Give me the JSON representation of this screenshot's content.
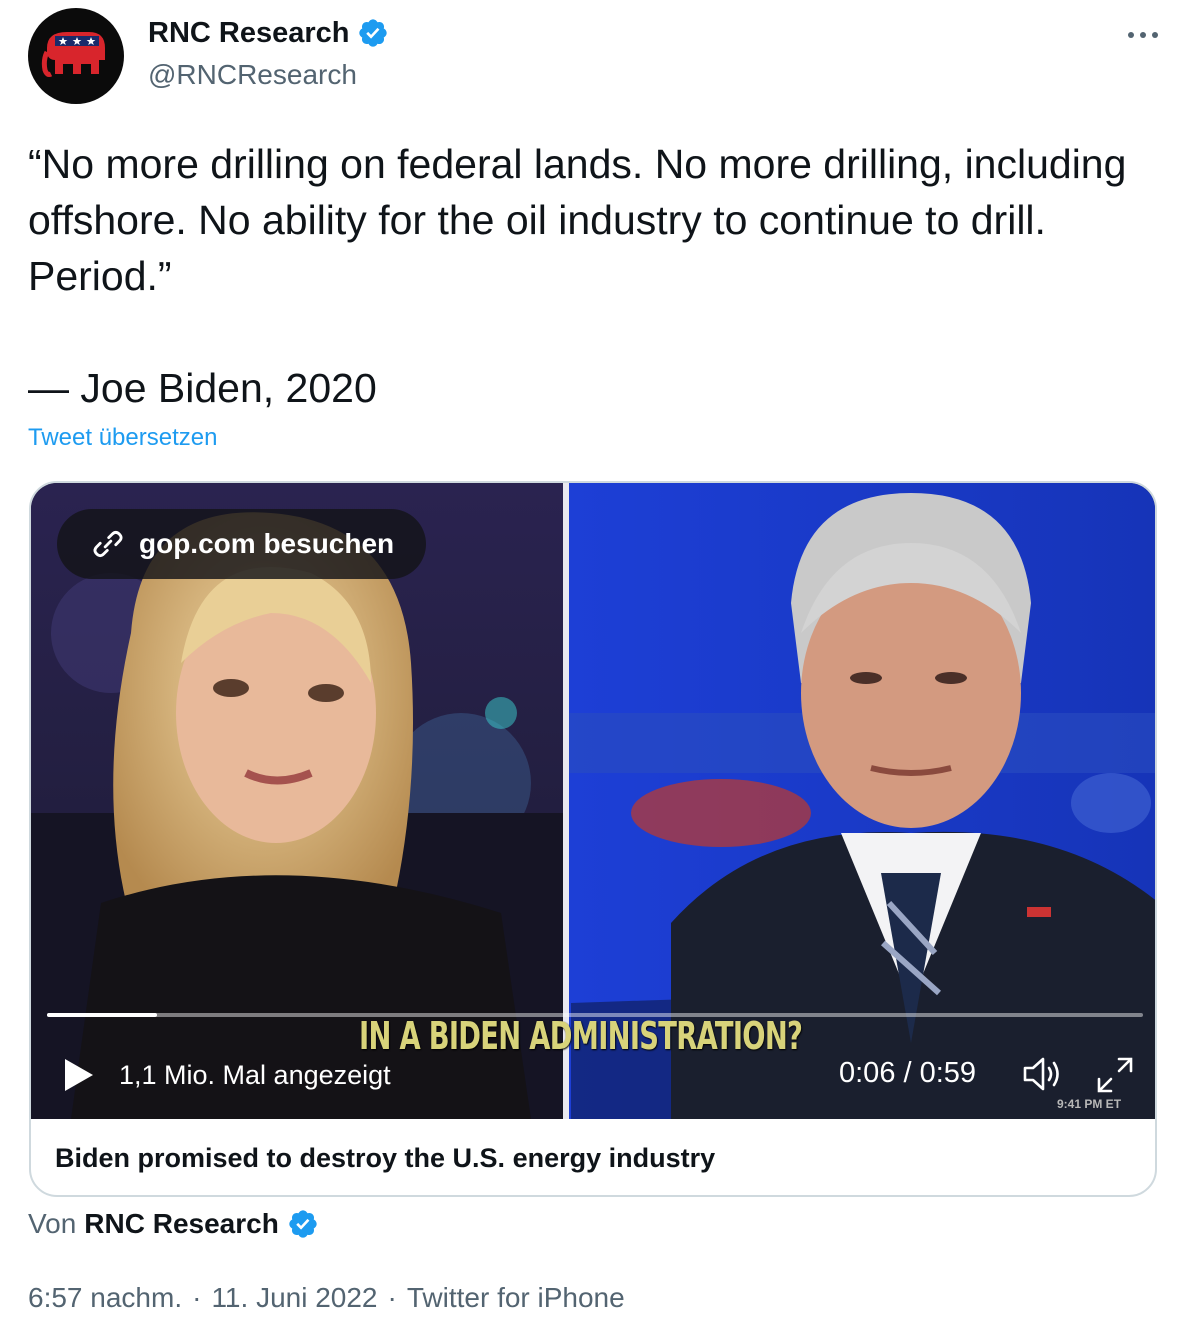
{
  "account": {
    "display_name": "RNC Research",
    "handle": "@RNCResearch",
    "verified": true,
    "avatar_icon": "gop-elephant-icon"
  },
  "more_icon": "more-dots-icon",
  "tweet": {
    "text": "“No more drilling on federal lands. No more drilling, including offshore. No ability for the oil industry to continue to drill. Period.”\n\n— Joe Biden, 2020",
    "translate_label": "Tweet übersetzen"
  },
  "video": {
    "visit_label": "gop.com besuchen",
    "views_label": "1,1 Mio. Mal angezeigt",
    "time_label": "0:06 / 0:59",
    "progress": 0.1,
    "caption": "IN A BIDEN ADMINISTRATION?",
    "tv_time": "9:41 PM ET"
  },
  "card": {
    "title": "Biden promised to destroy the U.S. energy industry"
  },
  "from": {
    "prefix": "Von",
    "name": "RNC Research"
  },
  "meta": {
    "time": "6:57 nachm.",
    "date": "11. Juni 2022",
    "source": "Twitter for iPhone",
    "separator": "·"
  },
  "colors": {
    "accent": "#1d9bf0",
    "secondary_text": "#536471",
    "border": "#cfd9de",
    "gop_red": "#d8252c"
  }
}
